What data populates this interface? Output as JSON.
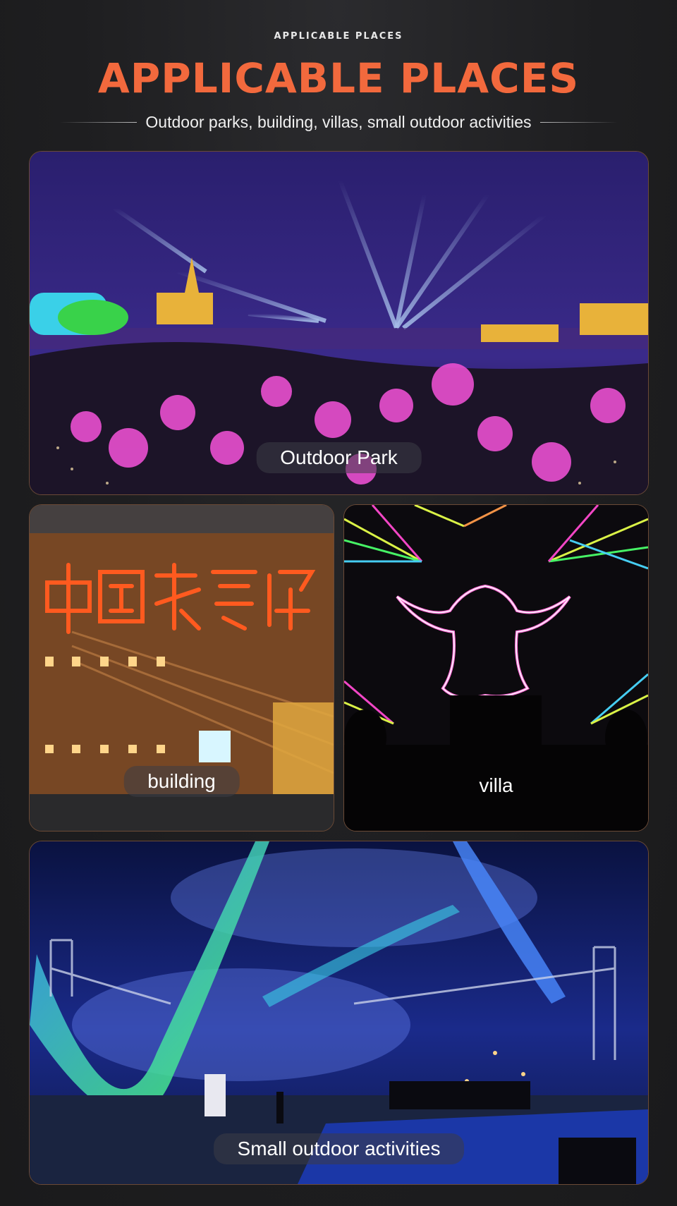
{
  "header": {
    "eyebrow": "APPLICABLE PLACES",
    "title": "APPLICABLE PLACES",
    "subtitle": "Outdoor parks, building, villas, small outdoor activities"
  },
  "colors": {
    "accent": "#f2693d",
    "background": "#1f1f21",
    "card_border": "#6b4a36"
  },
  "places": [
    {
      "caption": "Outdoor Park"
    },
    {
      "caption": "building"
    },
    {
      "caption": "villa"
    },
    {
      "caption": "Small outdoor activities"
    }
  ]
}
